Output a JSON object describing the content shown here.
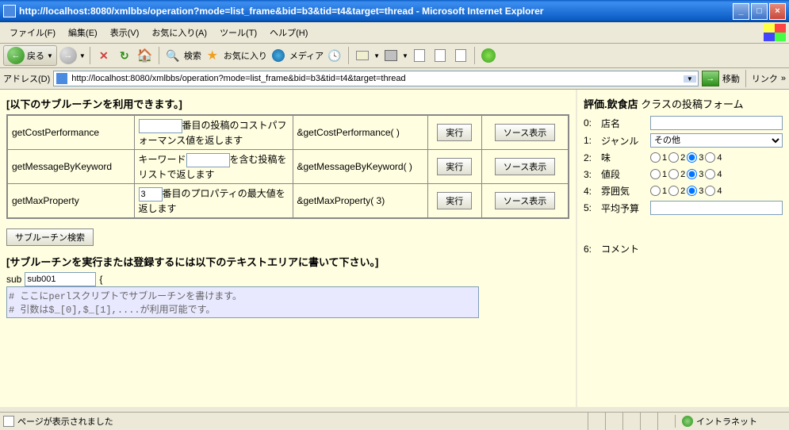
{
  "window": {
    "title": "http://localhost:8080/xmlbbs/operation?mode=list_frame&bid=b3&tid=t4&target=thread - Microsoft Internet Explorer",
    "minimize": "_",
    "maximize": "□",
    "close": "×"
  },
  "menu": {
    "file": "ファイル(F)",
    "edit": "編集(E)",
    "view": "表示(V)",
    "favorites": "お気に入り(A)",
    "tools": "ツール(T)",
    "help": "ヘルプ(H)"
  },
  "toolbar": {
    "back": "戻る",
    "search": "検索",
    "favorites": "お気に入り",
    "media": "メディア"
  },
  "address": {
    "label": "アドレス(D)",
    "url": "http://localhost:8080/xmlbbs/operation?mode=list_frame&bid=b3&tid=t4&target=thread",
    "go": "移動",
    "links": "リンク"
  },
  "left": {
    "heading1": "[以下のサブルーチンを利用できます。]",
    "rows": [
      {
        "name": "getCostPerformance",
        "desc_before": "",
        "desc_after": "番目の投稿のコストパフォーマンス値を返します",
        "input_value": "",
        "call": "&getCostPerformance( )",
        "exec": "実行",
        "source": "ソース表示"
      },
      {
        "name": "getMessageByKeyword",
        "desc_before": "キーワード",
        "desc_after": "を含む投稿をリストで返します",
        "input_value": "",
        "call": "&getMessageByKeyword( )",
        "exec": "実行",
        "source": "ソース表示"
      },
      {
        "name": "getMaxProperty",
        "desc_before": "",
        "desc_after": "番目のプロパティの最大値を返します",
        "input_value": "3",
        "call": "&getMaxProperty( 3)",
        "exec": "実行",
        "source": "ソース表示"
      }
    ],
    "search_btn": "サブルーチン検索",
    "heading2": "[サブルーチンを実行または登録するには以下のテキストエリアに書いて下さい。]",
    "sub_label": "sub",
    "sub_name": "sub001",
    "brace": "{",
    "textarea": "# ここにperlスクリプトでサブルーチンを書けます。\n# 引数は$_[0],$_[1],....が利用可能です。\n# 戻り値はreturn文で記述して下さい"
  },
  "right": {
    "title_bold": "評価.飲食店",
    "title_rest": " クラスの投稿フォーム",
    "fields": [
      {
        "num": "0:",
        "label": "店名",
        "type": "text",
        "value": ""
      },
      {
        "num": "1:",
        "label": "ジャンル",
        "type": "select",
        "value": "その他"
      },
      {
        "num": "2:",
        "label": "味",
        "type": "radio",
        "selected": 3
      },
      {
        "num": "3:",
        "label": "値段",
        "type": "radio",
        "selected": 3
      },
      {
        "num": "4:",
        "label": "雰囲気",
        "type": "radio",
        "selected": 3
      },
      {
        "num": "5:",
        "label": "平均予算",
        "type": "text",
        "value": ""
      },
      {
        "num": "6:",
        "label": "コメント",
        "type": "text",
        "value": ""
      }
    ],
    "radio_opts": [
      "1",
      "2",
      "3",
      "4"
    ]
  },
  "status": {
    "text": "ページが表示されました",
    "zone": "イントラネット"
  }
}
